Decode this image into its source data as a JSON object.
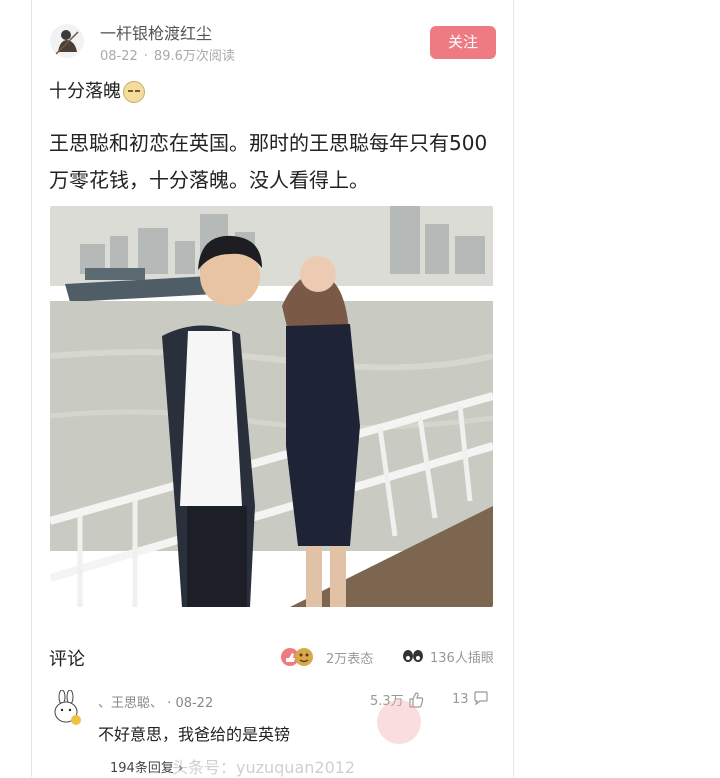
{
  "post": {
    "author_name": "一杆银枪渡红尘",
    "date": "08-22",
    "separator": "·",
    "views": "89.6万次阅读",
    "follow_label": "关注",
    "title": "十分落魄",
    "body": "王思聪和初恋在英国。那时的王思聪每年只有500万零花钱，十分落魄。没人看得上。"
  },
  "comments_section": {
    "label": "评论",
    "reactions_count": "2万表态",
    "eyes_count": "136人插眼"
  },
  "comment": {
    "author": "、王思聪、",
    "separator": "·",
    "date": "08-22",
    "likes": "5.3万",
    "reply_count": "13",
    "text": "不好意思，我爸给的是英镑",
    "more_replies": "194条回复 ›"
  },
  "watermark": "头条号：yuzuquan2012",
  "colors": {
    "follow_button": "#ef7b82",
    "muted_text": "#999999"
  }
}
